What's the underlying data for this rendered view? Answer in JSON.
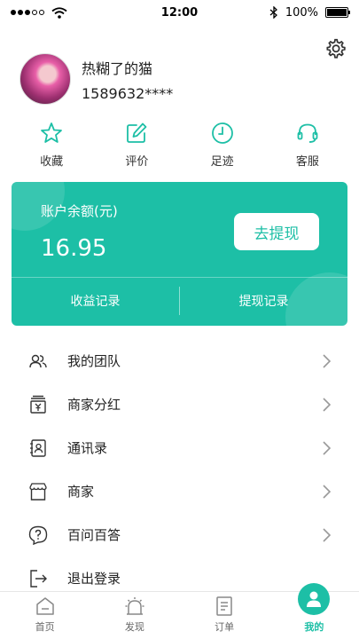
{
  "status_bar": {
    "time": "12:00",
    "battery": "100%",
    "battery_level": 1.0
  },
  "profile": {
    "username": "热糊了的猫",
    "phone": "1589632****"
  },
  "quick_actions": [
    {
      "label": "收藏",
      "icon": "star-icon"
    },
    {
      "label": "评价",
      "icon": "edit-icon"
    },
    {
      "label": "足迹",
      "icon": "clock-icon"
    },
    {
      "label": "客服",
      "icon": "headset-icon"
    }
  ],
  "balance_card": {
    "label": "账户余额(元)",
    "value": "16.95",
    "withdraw_button": "去提现",
    "income_records": "收益记录",
    "withdraw_records": "提现记录"
  },
  "menu": [
    {
      "label": "我的团队",
      "icon": "team-icon"
    },
    {
      "label": "商家分红",
      "icon": "bonus-icon"
    },
    {
      "label": "通讯录",
      "icon": "contacts-icon"
    },
    {
      "label": "商家",
      "icon": "store-icon"
    },
    {
      "label": "百问百答",
      "icon": "question-icon"
    },
    {
      "label": "退出登录",
      "icon": "logout-icon"
    }
  ],
  "tab_bar": [
    {
      "label": "首页",
      "icon": "home-icon"
    },
    {
      "label": "发现",
      "icon": "discover-icon"
    },
    {
      "label": "订单",
      "icon": "order-icon"
    },
    {
      "label": "我的",
      "icon": "profile-icon",
      "active": true
    }
  ],
  "colors": {
    "accent": "#1dbfa6",
    "text": "#222222",
    "muted": "#666666"
  }
}
